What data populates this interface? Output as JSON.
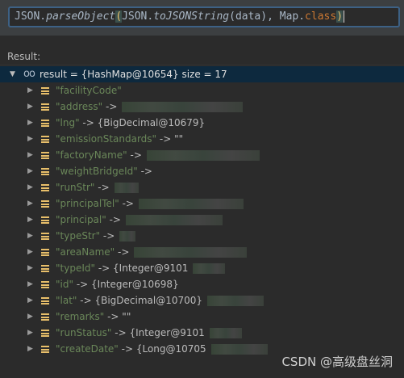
{
  "expression": {
    "p1": "JSON.",
    "p2": "parseObject",
    "p3": "(",
    "p4": "JSON.",
    "p5": "toJSONString",
    "p6": "(data), Map.",
    "p7": "class",
    "p8": ")"
  },
  "result_label": "Result:",
  "root": {
    "name": "result",
    "summary": " = {HashMap@10654}  size = 17"
  },
  "entries": [
    {
      "key": "\"facilityCode\"",
      "op": "",
      "value": ""
    },
    {
      "key": "\"address\"",
      "op": " ->",
      "value": ""
    },
    {
      "key": "\"lng\"",
      "op": " ->",
      "value": " {BigDecimal@10679}"
    },
    {
      "key": "\"emissionStandards\"",
      "op": " ->",
      "value": " \"\""
    },
    {
      "key": "\"factoryName\"",
      "op": " ->",
      "value": ""
    },
    {
      "key": "\"weightBridgeId\"",
      "op": " ->",
      "value": ""
    },
    {
      "key": "\"runStr\"",
      "op": " ->",
      "value": ""
    },
    {
      "key": "\"principalTel\"",
      "op": " ->",
      "value": ""
    },
    {
      "key": "\"principal\"",
      "op": " ->",
      "value": ""
    },
    {
      "key": "\"typeStr\"",
      "op": " ->",
      "value": ""
    },
    {
      "key": "\"areaName\"",
      "op": " ->",
      "value": ""
    },
    {
      "key": "\"typeId\"",
      "op": " ->",
      "value": " {Integer@9101"
    },
    {
      "key": "\"id\"",
      "op": " ->",
      "value": " {Integer@10698}"
    },
    {
      "key": "\"lat\"",
      "op": " ->",
      "value": " {BigDecimal@10700}"
    },
    {
      "key": "\"remarks\"",
      "op": " ->",
      "value": " \"\""
    },
    {
      "key": "\"runStatus\"",
      "op": " ->",
      "value": " {Integer@9101"
    },
    {
      "key": "\"createDate\"",
      "op": " ->",
      "value": " {Long@10705"
    }
  ],
  "watermark": "CSDN @高级盘丝洞"
}
